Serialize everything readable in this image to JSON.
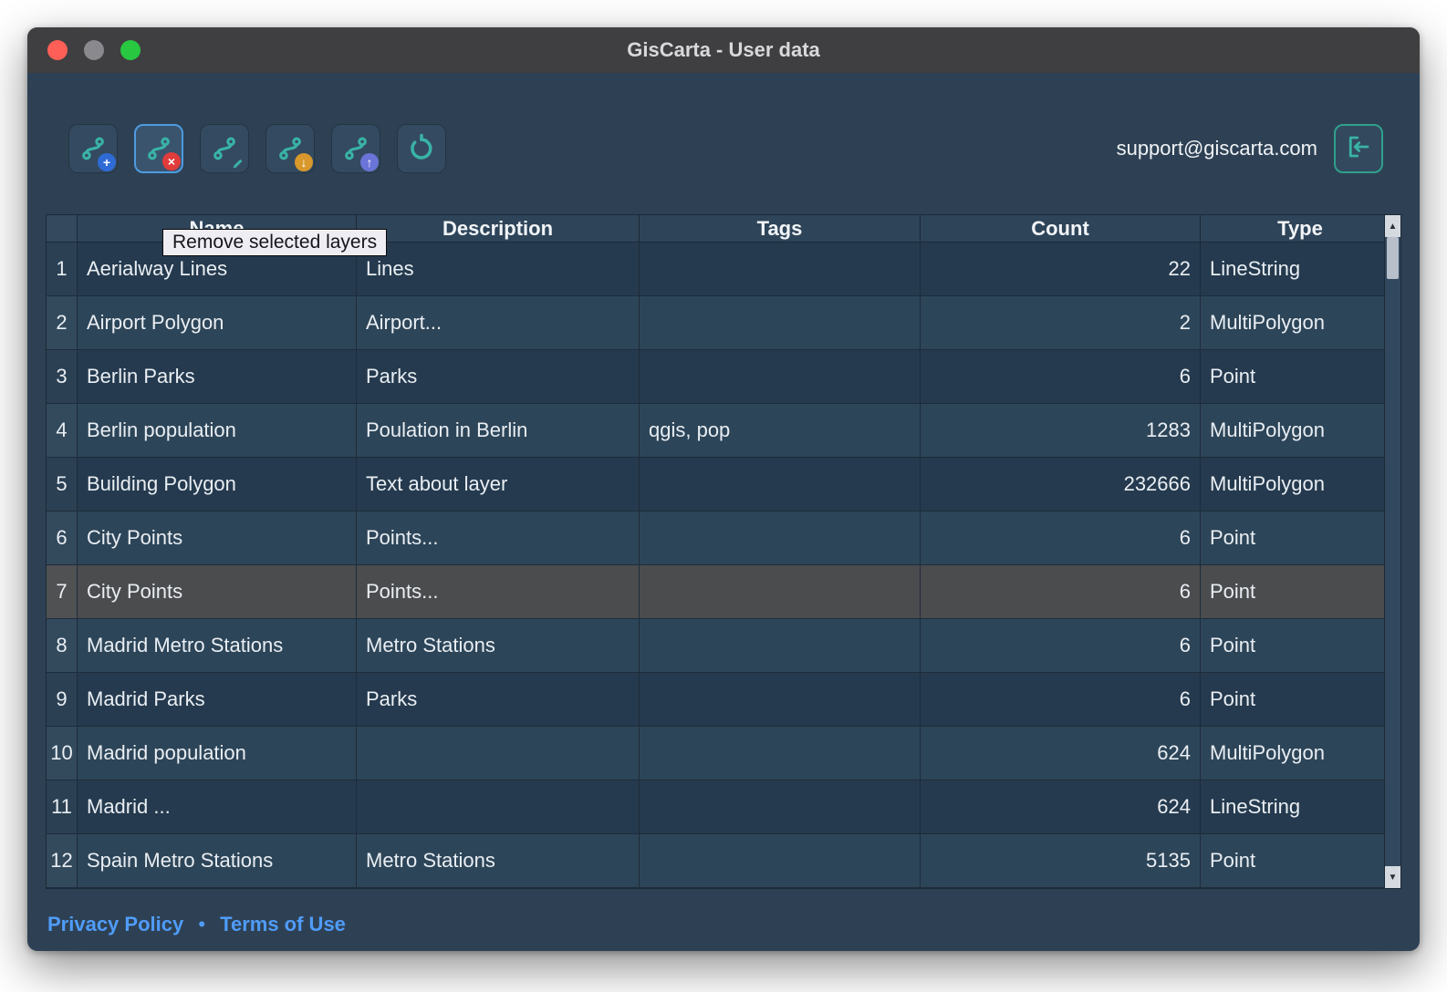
{
  "window": {
    "title": "GisCarta - User data"
  },
  "toolbar": {
    "email": "support@giscarta.com",
    "buttons": [
      {
        "name": "add-layer",
        "badge": "+",
        "selected": false
      },
      {
        "name": "remove-selected-layers",
        "badge": "×",
        "selected": true
      },
      {
        "name": "edit-layer",
        "badge": "pencil",
        "selected": false
      },
      {
        "name": "import-layer",
        "badge": "↓",
        "selected": false
      },
      {
        "name": "export-layer",
        "badge": "↑",
        "selected": false
      },
      {
        "name": "refresh",
        "badge": "",
        "selected": false
      }
    ]
  },
  "tooltip": {
    "text": "Remove selected layers"
  },
  "table": {
    "columns": [
      "Name",
      "Description",
      "Tags",
      "Count",
      "Type"
    ],
    "rows": [
      {
        "num": "1",
        "name": "Aerialway Lines",
        "description": "Lines",
        "tags": "",
        "count": "22",
        "type": "LineString",
        "selected": false
      },
      {
        "num": "2",
        "name": "Airport Polygon",
        "description": "Airport...",
        "tags": "",
        "count": "2",
        "type": "MultiPolygon",
        "selected": false
      },
      {
        "num": "3",
        "name": "Berlin Parks",
        "description": "Parks",
        "tags": "",
        "count": "6",
        "type": "Point",
        "selected": false
      },
      {
        "num": "4",
        "name": "Berlin population",
        "description": "Poulation in Berlin",
        "tags": "qgis, pop",
        "count": "1283",
        "type": "MultiPolygon",
        "selected": false
      },
      {
        "num": "5",
        "name": "Building Polygon",
        "description": "Text about layer",
        "tags": "",
        "count": "232666",
        "type": "MultiPolygon",
        "selected": false
      },
      {
        "num": "6",
        "name": "City Points",
        "description": "Points...",
        "tags": "",
        "count": "6",
        "type": "Point",
        "selected": false
      },
      {
        "num": "7",
        "name": "City Points",
        "description": "Points...",
        "tags": "",
        "count": "6",
        "type": "Point",
        "selected": true
      },
      {
        "num": "8",
        "name": "Madrid Metro Stations",
        "description": "Metro Stations",
        "tags": "",
        "count": "6",
        "type": "Point",
        "selected": false
      },
      {
        "num": "9",
        "name": "Madrid Parks",
        "description": "Parks",
        "tags": "",
        "count": "6",
        "type": "Point",
        "selected": false
      },
      {
        "num": "10",
        "name": "Madrid population",
        "description": "",
        "tags": "",
        "count": "624",
        "type": "MultiPolygon",
        "selected": false
      },
      {
        "num": "11",
        "name": "Madrid ...",
        "description": "",
        "tags": "",
        "count": "624",
        "type": "LineString",
        "selected": false
      },
      {
        "num": "12",
        "name": "Spain Metro Stations",
        "description": "Metro Stations",
        "tags": "",
        "count": "5135",
        "type": "Point",
        "selected": false
      }
    ]
  },
  "scrollbar": {
    "up": "▲",
    "down": "▼"
  },
  "footer": {
    "privacy": "Privacy Policy",
    "separator": "•",
    "terms": "Terms of Use"
  },
  "colors": {
    "accent_teal": "#39b3a6",
    "selection_border": "#4e9be0",
    "selected_row": "#4b4c4e",
    "link_blue": "#4f9cf9",
    "badge_add": "#2e6bd6",
    "badge_remove": "#e03c3c",
    "badge_import": "#d9982b",
    "badge_export": "#6b74d8",
    "traffic_close": "#ff5f57",
    "traffic_minimize": "#8a8a8e",
    "traffic_zoom": "#28c840",
    "window_bg": "#2e4154",
    "titlebar_bg": "#3f3f41"
  }
}
